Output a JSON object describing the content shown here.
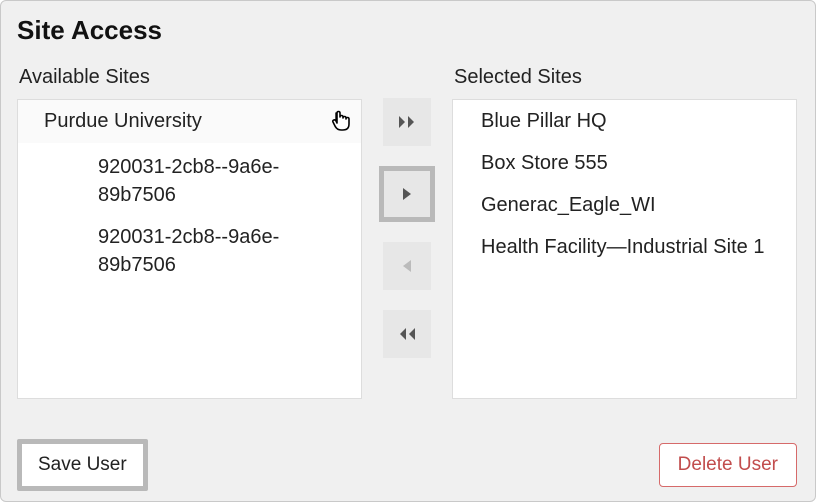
{
  "panel": {
    "title": "Site Access"
  },
  "available": {
    "label": "Available Sites",
    "parent": "Purdue University",
    "children": [
      "920031-2cb8--9a6e-89b7506",
      "920031-2cb8--9a6e-89b7506"
    ]
  },
  "controls": {
    "move_all_right": "▸▸",
    "move_right": "▸",
    "move_left": "◂",
    "move_all_left": "◂◂"
  },
  "selected": {
    "label": "Selected Sites",
    "items": [
      "Blue Pillar HQ",
      "Box Store 555",
      "Generac_Eagle_WI",
      "Health Facility—Industrial Site 1"
    ]
  },
  "footer": {
    "save": "Save User",
    "delete": "Delete User"
  }
}
